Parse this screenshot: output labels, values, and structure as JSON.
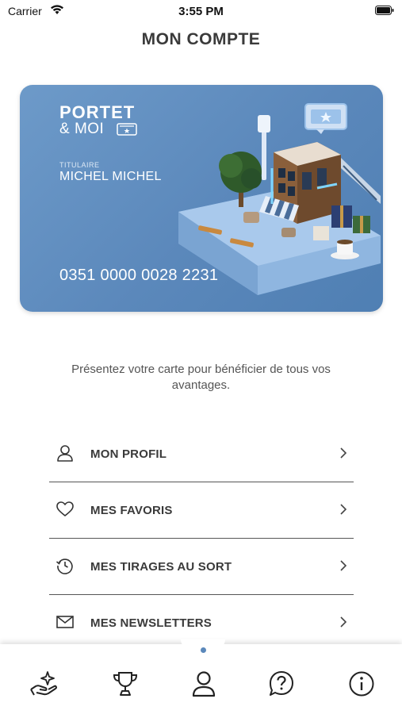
{
  "status_bar": {
    "carrier": "Carrier",
    "time": "3:55 PM",
    "icons": [
      "wifi-icon",
      "battery-icon"
    ]
  },
  "header": {
    "title": "MON COMPTE"
  },
  "card": {
    "brand_line1": "PORTET",
    "brand_line2": "& MOI",
    "holder_label": "TITULAIRE",
    "holder_name": "MICHEL MICHEL",
    "number": "0351 0000 0028 2231",
    "accent_color": "#5b88bb"
  },
  "info_text": "Présentez votre carte pour bénéficier de tous vos avantages.",
  "menu": [
    {
      "label": "MON PROFIL",
      "icon": "user-icon"
    },
    {
      "label": "MES FAVORIS",
      "icon": "heart-icon"
    },
    {
      "label": "MES TIRAGES AU SORT",
      "icon": "history-icon"
    },
    {
      "label": "MES NEWSLETTERS",
      "icon": "envelope-icon"
    }
  ],
  "tabbar": {
    "items": [
      {
        "icon": "hand-sparkle-icon"
      },
      {
        "icon": "trophy-icon"
      },
      {
        "icon": "user-icon",
        "active": true
      },
      {
        "icon": "help-icon"
      },
      {
        "icon": "info-icon"
      }
    ]
  }
}
